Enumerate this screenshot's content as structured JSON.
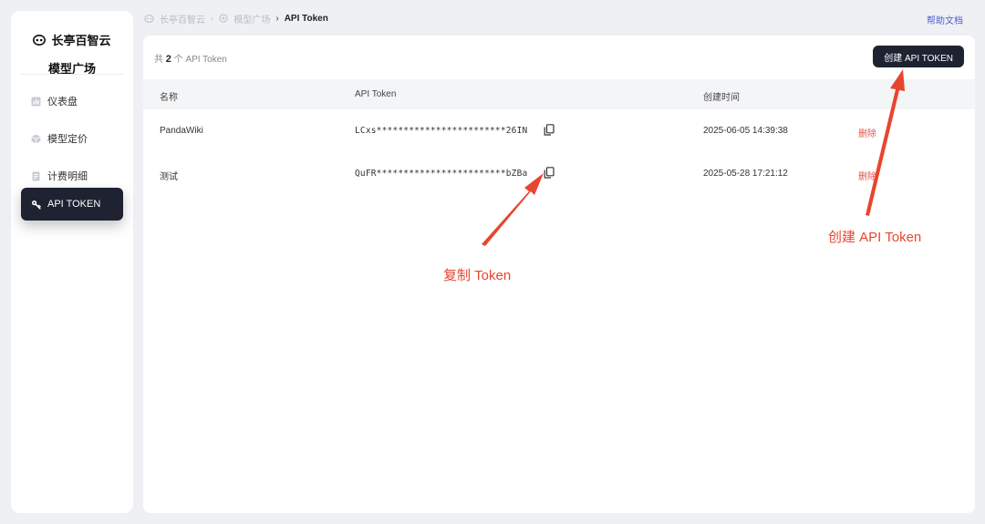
{
  "sidebar": {
    "brand": "长亭百智云",
    "subtitle": "模型广场",
    "items": [
      {
        "label": "仪表盘",
        "icon": "chart-icon",
        "active": false
      },
      {
        "label": "模型定价",
        "icon": "box-icon",
        "active": false
      },
      {
        "label": "计费明细",
        "icon": "receipt-icon",
        "active": false
      },
      {
        "label": "API TOKEN",
        "icon": "key-icon",
        "active": true
      }
    ]
  },
  "breadcrumb": {
    "items": [
      "长亭百智云",
      "模型广场",
      "API Token"
    ]
  },
  "header": {
    "help_label": "帮助文档"
  },
  "main": {
    "count_prefix": "共",
    "count_value": "2",
    "count_suffix": "个 API Token",
    "create_button_label": "创建 API TOKEN",
    "columns": {
      "name": "名称",
      "token": "API Token",
      "created": "创建时间"
    },
    "rows": [
      {
        "name": "PandaWiki",
        "token": "LCxs************************26IN",
        "created": "2025-06-05 14:39:38",
        "action": "删除"
      },
      {
        "name": "测试",
        "token": "QuFR************************bZBa",
        "created": "2025-05-28 17:21:12",
        "action": "删除"
      }
    ]
  },
  "annotations": {
    "copy_token": "复制 Token",
    "create_token": "创建 API Token",
    "color": "#e8452f"
  },
  "colors": {
    "accent_dark": "#1f2230",
    "danger": "#e5534b",
    "link": "#4b5fd1"
  }
}
